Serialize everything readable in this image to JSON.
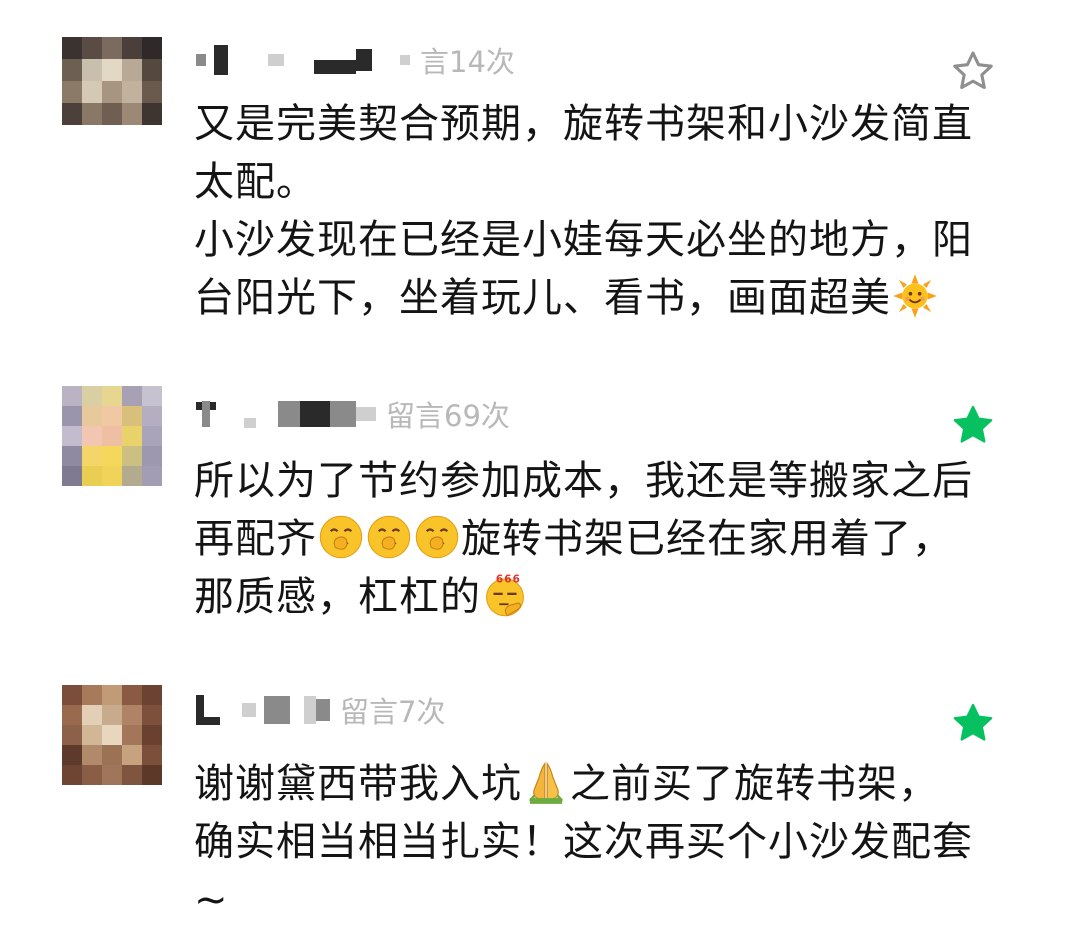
{
  "comments": [
    {
      "count_label": "言14次",
      "starred": false,
      "lines": [
        "又是完美契合预期，旋转书架和小沙发简直",
        "太配。",
        "小沙发现在已经是小娃每天必坐的地方，阳",
        "台阳光下，坐着玩儿、看书，画面超美"
      ],
      "emojis": [
        "sun-emoji"
      ]
    },
    {
      "count_label": "留言69次",
      "starred": true,
      "lines": [
        "所以为了节约参加成本，我还是等搬家之后",
        "再配齐",
        "旋转书架已经在家用着了，",
        "那质感，杠杠的"
      ],
      "emojis": [
        "shy-face-emoji",
        "shy-face-emoji",
        "shy-face-emoji",
        "666-face-emoji"
      ]
    },
    {
      "count_label": "留言7次",
      "starred": true,
      "lines": [
        "谢谢黛西带我入坑",
        "之前买了旋转书架，",
        "确实相当相当扎实！这次再买个小沙发配套",
        "~"
      ],
      "emojis": [
        "folded-hands-emoji"
      ]
    }
  ],
  "colors": {
    "star_active": "#07c160",
    "star_inactive": "#8f8f8f",
    "count_text": "#b8b8b8",
    "body_text": "#141414"
  }
}
